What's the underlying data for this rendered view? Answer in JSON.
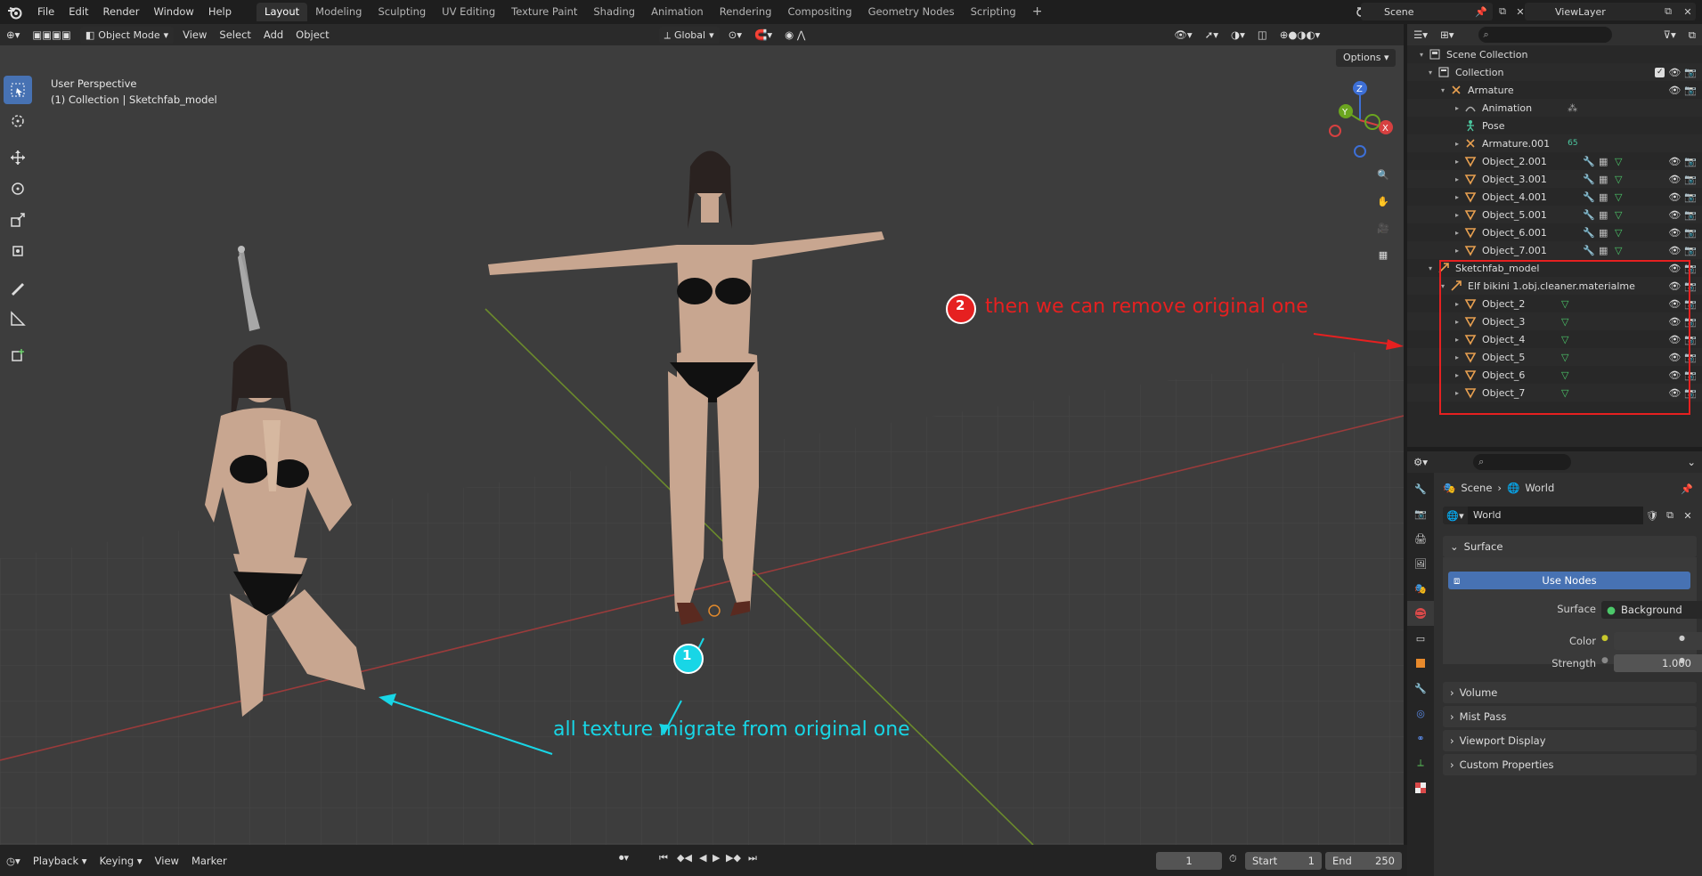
{
  "topbar": {
    "menus": [
      "File",
      "Edit",
      "Render",
      "Window",
      "Help"
    ],
    "workspaces": [
      "Layout",
      "Modeling",
      "Sculpting",
      "UV Editing",
      "Texture Paint",
      "Shading",
      "Animation",
      "Rendering",
      "Compositing",
      "Geometry Nodes",
      "Scripting"
    ],
    "active_workspace": "Layout",
    "scene_value": "Scene",
    "viewlayer_value": "ViewLayer"
  },
  "viewport": {
    "mode": "Object Mode",
    "menus": [
      "View",
      "Select",
      "Add",
      "Object"
    ],
    "transform_orientation": "Global",
    "options_label": "Options",
    "perspective_label": "User Perspective",
    "collection_label": "(1) Collection | Sketchfab_model",
    "gizmo_axes": {
      "z": "Z",
      "y": "Y",
      "x": "X"
    }
  },
  "annotations": {
    "one": {
      "number": "1",
      "text": "all texture migrate from original one",
      "color": "#18d6e6"
    },
    "two": {
      "number": "2",
      "text": "then we can remove original one",
      "color": "#e62020"
    }
  },
  "outliner": {
    "root": "Scene Collection",
    "collection": "Collection",
    "armature": "Armature",
    "animation": "Animation",
    "pose": "Pose",
    "armature001": "Armature.001",
    "armature001_badge": "65",
    "objects_001": [
      "Object_2.001",
      "Object_3.001",
      "Object_4.001",
      "Object_5.001",
      "Object_6.001",
      "Object_7.001"
    ],
    "sketchfab": "Sketchfab_model",
    "elf": "Elf bikini 1.obj.cleaner.materialme",
    "objects": [
      "Object_2",
      "Object_3",
      "Object_4",
      "Object_5",
      "Object_6",
      "Object_7"
    ]
  },
  "properties": {
    "breadcrumb_scene": "Scene",
    "breadcrumb_world": "World",
    "world_name": "World",
    "surface_panel": "Surface",
    "use_nodes": "Use Nodes",
    "surface_label": "Surface",
    "surface_value": "Background",
    "color_label": "Color",
    "strength_label": "Strength",
    "strength_value": "1.000",
    "panels": [
      "Volume",
      "Mist Pass",
      "Viewport Display",
      "Custom Properties"
    ]
  },
  "timeline": {
    "menus": [
      "Playback",
      "Keying",
      "View",
      "Marker"
    ],
    "current_frame": "1",
    "start_label": "Start",
    "start_value": "1",
    "end_label": "End",
    "end_value": "250"
  }
}
